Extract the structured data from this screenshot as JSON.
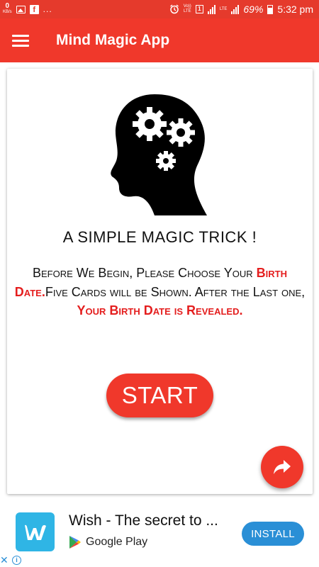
{
  "status_bar": {
    "speed_value": "0",
    "speed_unit": "KB/s",
    "overflow": "...",
    "facebook_glyph": "f",
    "volte_top": "Vo))",
    "volte_bottom": "LTE",
    "sim_number": "1",
    "lte_label": "LTE",
    "battery_percent": "69%",
    "time": "5:32 pm"
  },
  "app_bar": {
    "title": "Mind Magic App",
    "menu_icon": "hamburger-icon"
  },
  "main": {
    "trick_title": "A SIMPLE MAGIC TRICK !",
    "desc_part1": "Before We Begin, Please Choose Your ",
    "desc_highlight1": "Birth Date.",
    "desc_part2": "Five Cards will be Shown. After the Last one, ",
    "desc_highlight2": "Your Birth Date is Revealed.",
    "start_label": "START",
    "share_icon": "share-arrow-icon",
    "head_icon": "head-gears-icon"
  },
  "ad": {
    "title": "Wish - The secret to ...",
    "store": "Google Play",
    "install_label": "INSTALL",
    "logo_letter": "w",
    "close_glyph": "✕",
    "info_glyph": "i"
  },
  "colors": {
    "primary": "#f0382b",
    "highlight": "#e41e1e",
    "install": "#2a8fd6",
    "wish": "#2fb5e5"
  }
}
